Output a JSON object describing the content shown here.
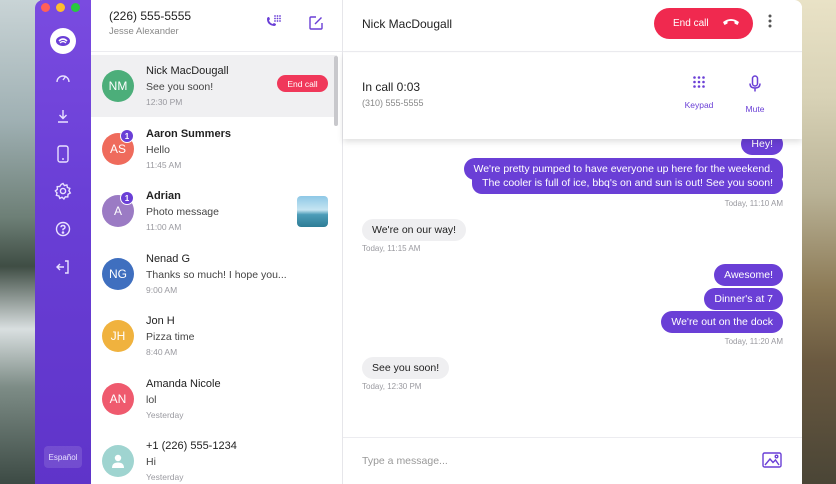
{
  "account": {
    "phone": "(226) 555-5555",
    "name": "Jesse Alexander"
  },
  "sidebar": {
    "language": "Español"
  },
  "conversations": [
    {
      "initials": "NM",
      "name": "Nick MacDougall",
      "message": "See you soon!",
      "time": "12:30 PM",
      "color": "#4cae7a",
      "action": "End call",
      "unread": ""
    },
    {
      "initials": "AS",
      "name": "Aaron Summers",
      "message": "Hello",
      "time": "11:45 AM",
      "color": "#ef6b5c",
      "unread": "1"
    },
    {
      "initials": "A",
      "name": "Adrian",
      "message": "Photo message",
      "time": "11:00 AM",
      "color": "#9b7bc4",
      "unread": "1"
    },
    {
      "initials": "NG",
      "name": "Nenad G",
      "message": "Thanks so much! I hope you...",
      "time": "9:00 AM",
      "color": "#3f6fbf",
      "unread": ""
    },
    {
      "initials": "JH",
      "name": "Jon H",
      "message": "Pizza time",
      "time": "8:40 AM",
      "color": "#f0b23e",
      "unread": ""
    },
    {
      "initials": "AN",
      "name": "Amanda Nicole",
      "message": "lol",
      "time": "Yesterday",
      "color": "#ef5a6e",
      "unread": ""
    },
    {
      "initials": "",
      "name": "+1 (226) 555-1234",
      "message": "Hi",
      "time": "Yesterday",
      "color": "#9fd4d0",
      "unread": ""
    }
  ],
  "chat": {
    "title": "Nick MacDougall",
    "end_call_label": "End call",
    "call_status": "In call 0:03",
    "call_number": "(310) 555-5555",
    "keypad_label": "Keypad",
    "mute_label": "Mute",
    "messages": [
      {
        "dir": "out",
        "text": "Hey!"
      },
      {
        "dir": "out",
        "text": "We're pretty pumped to have everyone up here for the weekend."
      },
      {
        "dir": "out",
        "text": "The cooler is full of ice, bbq's on and sun is out!  See you soon!"
      },
      {
        "dir": "stamp-out",
        "text": "Today, 11:10 AM"
      },
      {
        "dir": "in",
        "text": "We're on our way!"
      },
      {
        "dir": "stamp-in",
        "text": "Today, 11:15 AM"
      },
      {
        "dir": "out",
        "text": "Awesome!"
      },
      {
        "dir": "out",
        "text": "Dinner's at 7"
      },
      {
        "dir": "out",
        "text": "We're out on the dock"
      },
      {
        "dir": "stamp-out",
        "text": "Today, 11:20 AM"
      },
      {
        "dir": "in",
        "text": "See you soon!"
      },
      {
        "dir": "stamp-in",
        "text": "Today, 12:30 PM"
      }
    ],
    "compose_placeholder": "Type a message..."
  },
  "colors": {
    "accent": "#6a3fd6",
    "danger": "#f0294f"
  }
}
